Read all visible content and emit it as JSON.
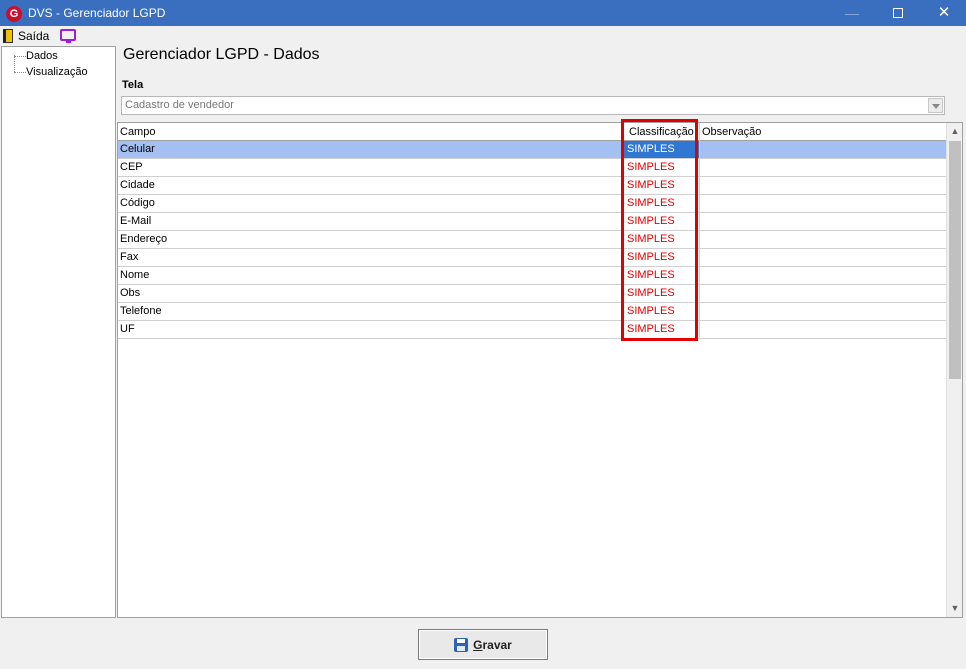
{
  "window": {
    "title": "DVS - Gerenciador LGPD",
    "minimize_glyph": "—",
    "close_glyph": "✕"
  },
  "menu": {
    "exit_label": "Saída"
  },
  "tree": {
    "items": [
      {
        "label": "Dados"
      },
      {
        "label": "Visualização"
      }
    ]
  },
  "main": {
    "heading": "Gerenciador LGPD - Dados",
    "tela_label": "Tela",
    "tela_value": "Cadastro de vendedor"
  },
  "grid": {
    "columns": [
      "Campo",
      "Classificação",
      "Observação"
    ],
    "rows": [
      {
        "campo": "Celular",
        "classificacao": "SIMPLES",
        "observacao": ""
      },
      {
        "campo": "CEP",
        "classificacao": "SIMPLES",
        "observacao": ""
      },
      {
        "campo": "Cidade",
        "classificacao": "SIMPLES",
        "observacao": ""
      },
      {
        "campo": "Código",
        "classificacao": "SIMPLES",
        "observacao": ""
      },
      {
        "campo": "E-Mail",
        "classificacao": "SIMPLES",
        "observacao": ""
      },
      {
        "campo": "Endereço",
        "classificacao": "SIMPLES",
        "observacao": ""
      },
      {
        "campo": "Fax",
        "classificacao": "SIMPLES",
        "observacao": ""
      },
      {
        "campo": "Nome",
        "classificacao": "SIMPLES",
        "observacao": ""
      },
      {
        "campo": "Obs",
        "classificacao": "SIMPLES",
        "observacao": ""
      },
      {
        "campo": "Telefone",
        "classificacao": "SIMPLES",
        "observacao": ""
      },
      {
        "campo": "UF",
        "classificacao": "SIMPLES",
        "observacao": ""
      }
    ],
    "selected_index": 0
  },
  "footer": {
    "save_label_first": "G",
    "save_label_rest": "ravar"
  },
  "icons": {
    "app": "dvs-logo-icon",
    "exit": "door-icon",
    "monitor": "monitor-icon",
    "save": "floppy-disk-icon"
  },
  "colors": {
    "titlebar": "#3a6fbf",
    "selected_row": "#a4bff1",
    "selected_cell": "#2f77d0",
    "classification_text": "#e00000",
    "highlight_border": "#e00000"
  }
}
